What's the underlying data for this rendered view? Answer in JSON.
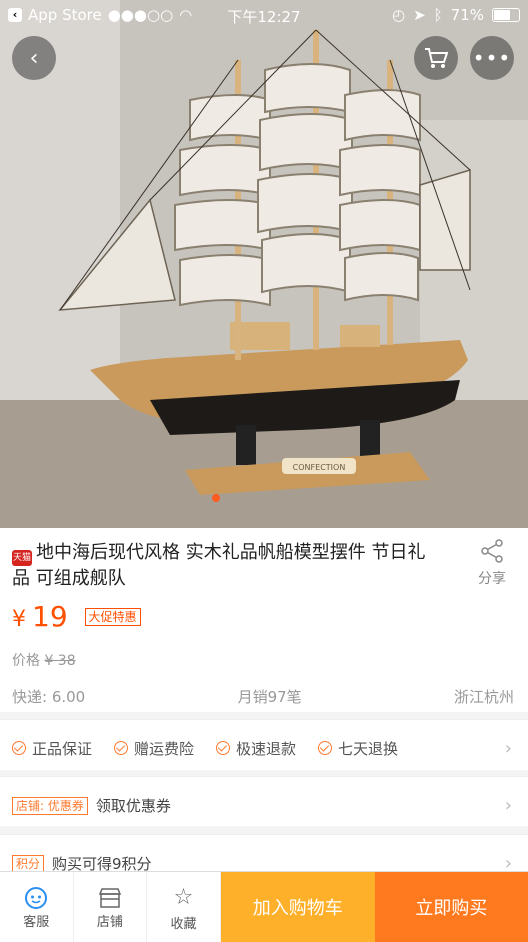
{
  "status_bar": {
    "back_app": "App Store",
    "signal": "●●●○○",
    "time": "下午12:27",
    "battery": "71%"
  },
  "product": {
    "badge": "天猫",
    "title": "地中海后现代风格 实木礼品帆船模型摆件 节日礼品 可组成舰队",
    "share_label": "分享",
    "price_symbol": "¥",
    "price": "19",
    "promo_tag": "大促特惠",
    "orig_price_label": "价格",
    "orig_price": "¥ 38",
    "shipping": "快递: 6.00",
    "monthly_sales": "月销97笔",
    "location": "浙江杭州"
  },
  "guarantees": [
    "正品保证",
    "赠运费险",
    "极速退款",
    "七天退换"
  ],
  "coupon_row": {
    "tag": "店铺: 优惠券",
    "text": "领取优惠券"
  },
  "points_row": {
    "tag": "积分",
    "text": "购买可得9积分"
  },
  "bottom_bar": {
    "service": "客服",
    "store": "店铺",
    "favorite": "收藏",
    "add_to_cart": "加入购物车",
    "buy_now": "立即购买"
  },
  "colors": {
    "accent": "#ff5000",
    "cart": "#ffb02a",
    "buy": "#ff7a1e"
  },
  "hero_image_text": "CONFECTION"
}
